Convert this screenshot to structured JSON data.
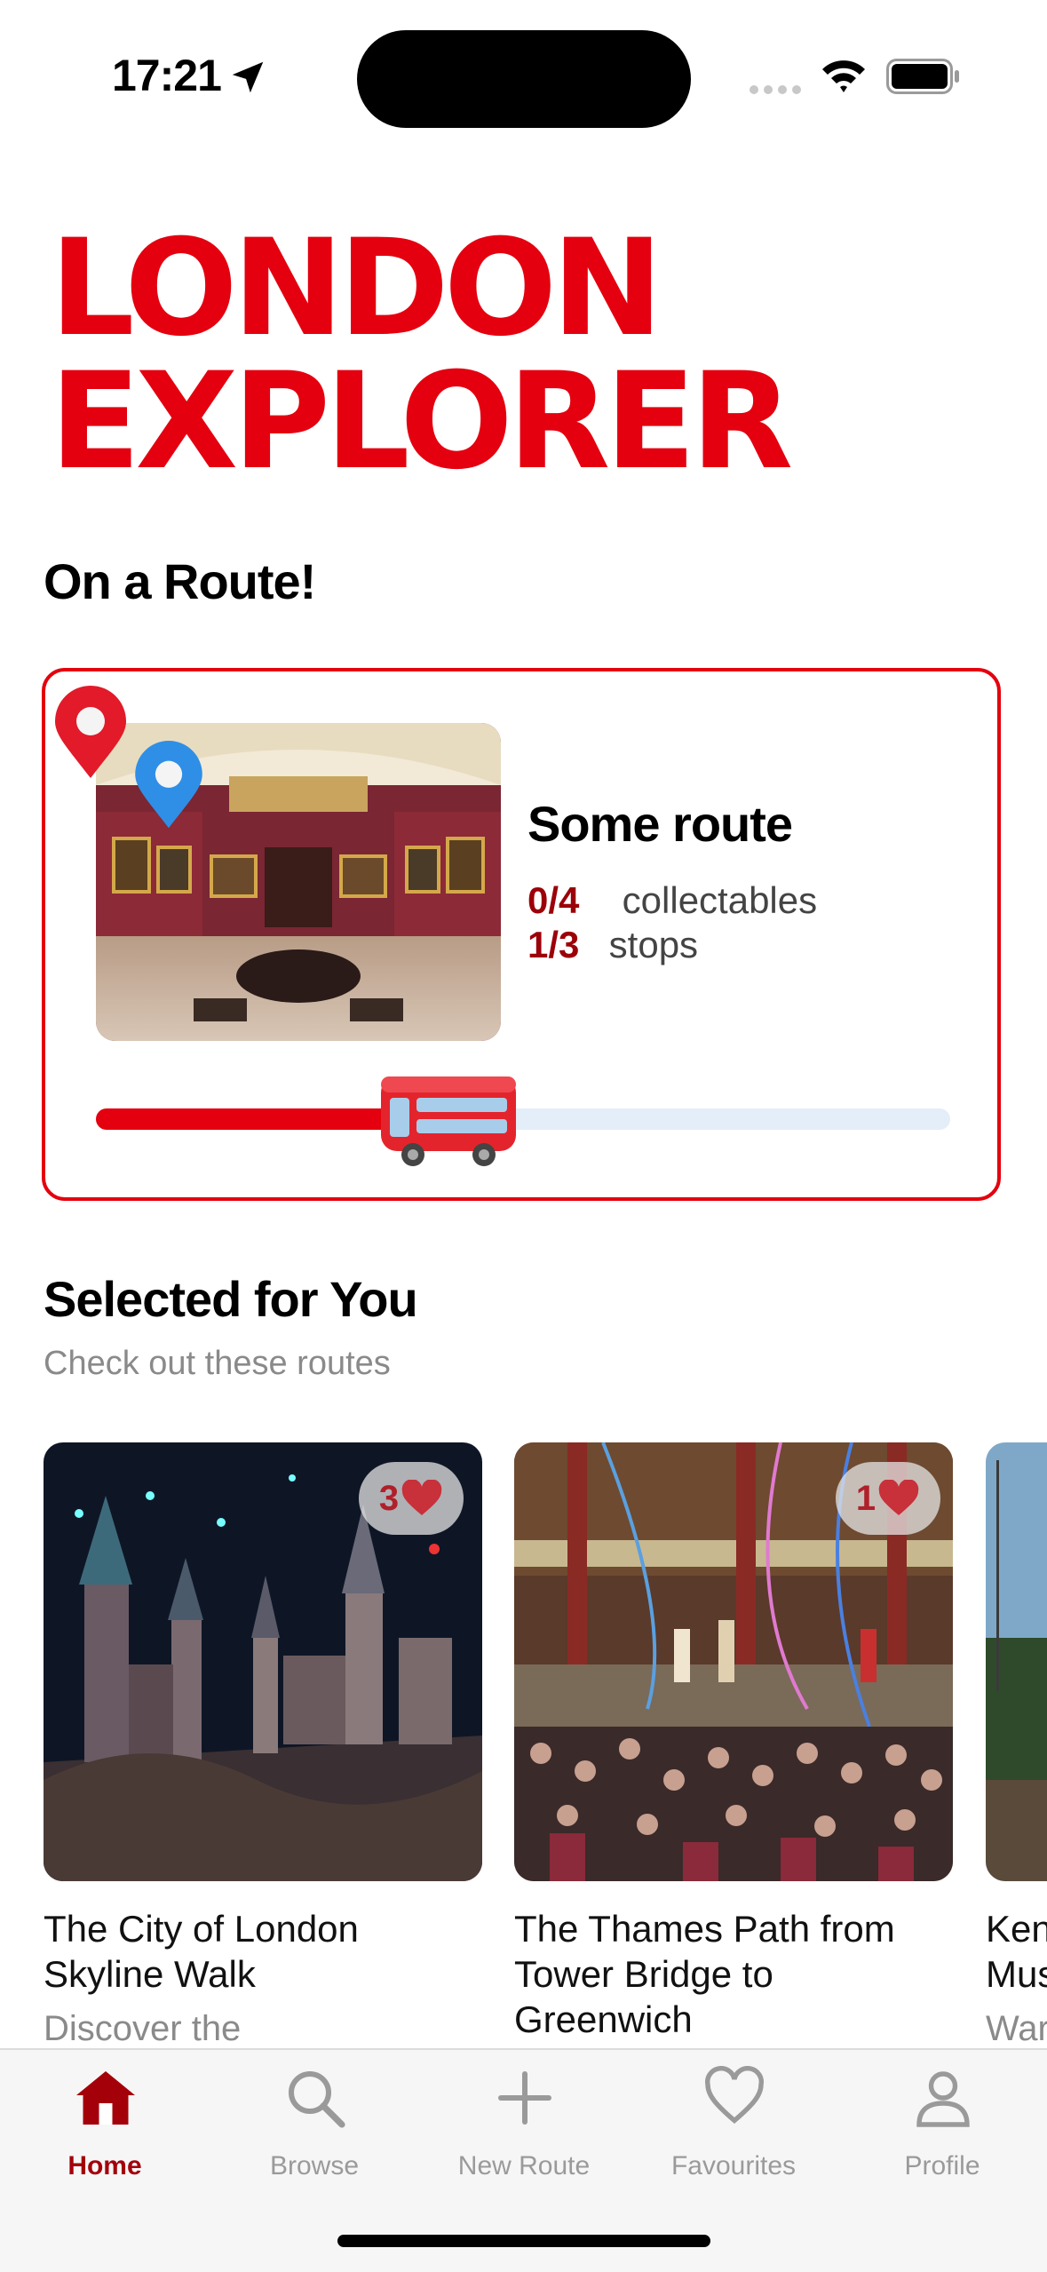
{
  "status_bar": {
    "time": "17:21"
  },
  "logo": {
    "line1": "LONDON",
    "line2": "EXPLORER"
  },
  "current_route": {
    "heading": "On a Route!",
    "name": "Some route",
    "collectables_count": "0/4",
    "collectables_label": "collectables",
    "stops_count": "1/3",
    "stops_label": "stops",
    "progress": 0.33
  },
  "selected": {
    "heading": "Selected for You",
    "subtitle": "Check out these routes",
    "cards": [
      {
        "title": "The City of London Skyline Walk",
        "description": "Discover the",
        "likes": "3"
      },
      {
        "title": "The Thames Path from Tower Bridge to Greenwich",
        "description": "",
        "likes": "1"
      },
      {
        "title": "Ken Mus",
        "description": "War",
        "likes": ""
      }
    ]
  },
  "tabbar": {
    "items": [
      {
        "label": "Home",
        "icon": "house-icon",
        "active": true
      },
      {
        "label": "Browse",
        "icon": "search-icon",
        "active": false
      },
      {
        "label": "New Route",
        "icon": "plus-icon",
        "active": false
      },
      {
        "label": "Favourites",
        "icon": "heart-icon",
        "active": false
      },
      {
        "label": "Profile",
        "icon": "person-icon",
        "active": false
      }
    ]
  },
  "colors": {
    "brand_red": "#e4000f",
    "dark_red": "#9c0008",
    "track": "#e3eef8"
  }
}
